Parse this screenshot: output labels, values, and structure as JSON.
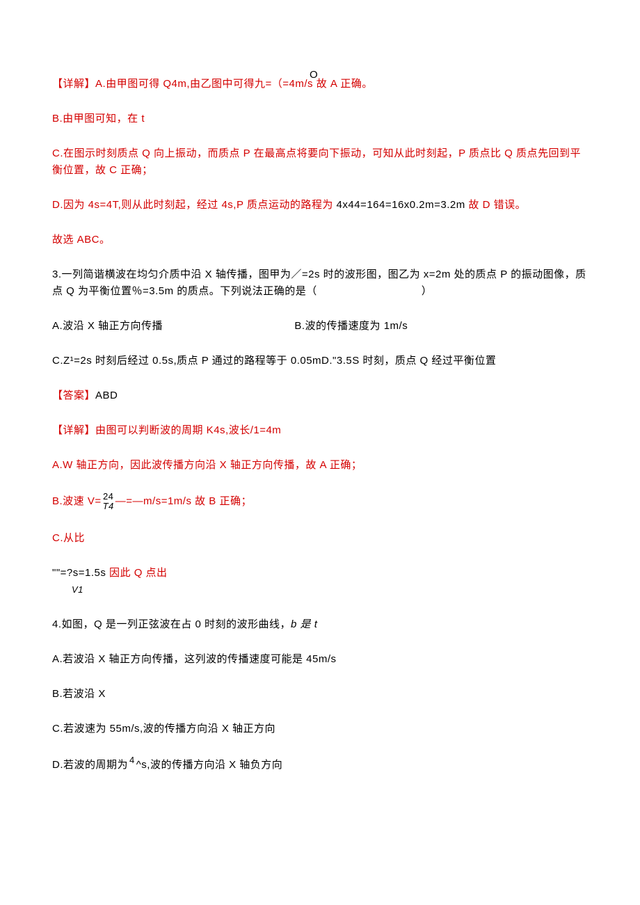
{
  "p1": {
    "o": "O",
    "a_label": "【详解】A.",
    "a_text": "由甲图可得 Q4m,由乙图中可得九=（=4m/s",
    "a_tail": "故 A 正确。"
  },
  "p2": {
    "text": "B.由甲图可知，在 t"
  },
  "p3": {
    "head": "C.在图示时刻质点 Q 向上振动，而质点 P 在最高点将要向下振动，可知从此时刻起，P 质点比 Q 质点先回到平衡位置，故 C 正确；"
  },
  "p4": {
    "head": "D.因为 4s=4T,则从此时刻起，经过 4s,P 质点运动的路程为 ",
    "mid": "4x44=164=16x0.2m=3.2m",
    "tail": " 故 D 错误。"
  },
  "p5": {
    "text": "故选 ABC。"
  },
  "q3": {
    "stem_a": "3.一列简谐横波在均匀介质中沿 X 轴传播，图甲为／=2s 时的波形图，图乙为 x=2m 处的质点 P 的振动图像，质点 Q 为平衡位置％=3.5m 的质点。下列说法正确的是（",
    "stem_b": "）",
    "a": "A.波沿 X 轴正方向传播",
    "b": "B.波的传播速度为 1m/s",
    "c": "C.Z¹=2s 时刻后经过 0.5s,质点 P 通过的路程等于 0.05mD.\"3.5S 时刻，质点 Q 经过平衡位置"
  },
  "ans3": {
    "label": "【答案】",
    "val": "ABD"
  },
  "det3": {
    "label": "【详解】",
    "text": "由图可以判断波的周期 K4s,波长/1=4m"
  },
  "d3a": {
    "text": "A.W 轴正方向，因此波传播方向沿 X 轴正方向传播，故 A 正确；"
  },
  "d3b": {
    "pre": "B.波速 V=—=—m/s=1m/s",
    "frac_top": "24",
    "frac_bot": "T4",
    "tail": " 故 B 正确；"
  },
  "d3c": {
    "text": "C.从比"
  },
  "d3d": {
    "pre": "\"\"=?s=1.5s ",
    "tail": "因此 Q 点出",
    "frac_bot": "V1"
  },
  "q4": {
    "stem": "4.如图，Q 是一列正弦波在占 0 时刻的波形曲线，b 是 t",
    "b_italic": "b 是 t",
    "a": "A.若波沿 X 轴正方向传播，这列波的传播速度可能是 45m/s",
    "b": "B.若波沿 X",
    "c": "C.若波速为 55m/s,波的传播方向沿 X 轴正方向",
    "d_pre": "D.若波的周期为^s,波的传播方向沿 X 轴负方向",
    "d_frac_top": "4"
  }
}
